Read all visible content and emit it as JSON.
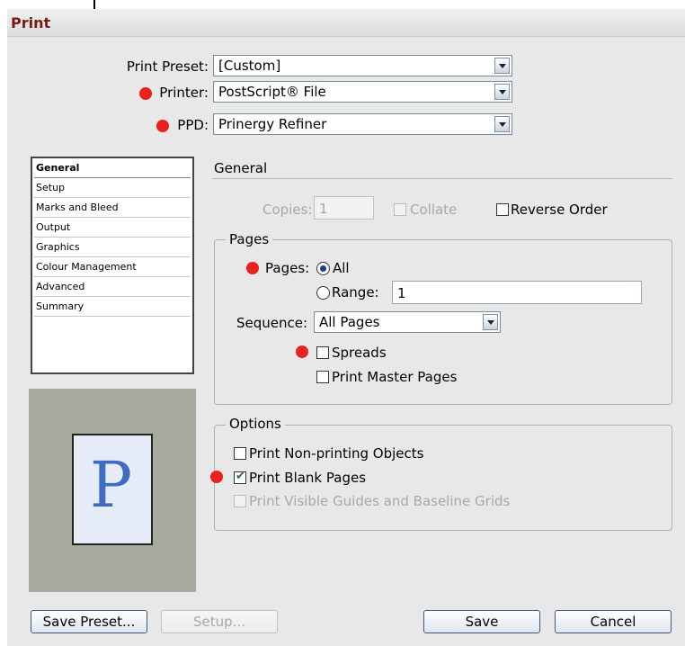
{
  "dialog": {
    "title": "Print"
  },
  "top": {
    "print_preset": {
      "label": "Print Preset:",
      "value": "[Custom]"
    },
    "printer": {
      "label": "Printer:",
      "value": "PostScript® File"
    },
    "ppd": {
      "label": "PPD:",
      "value": "Prinergy Refiner"
    }
  },
  "sidebar": {
    "items": [
      {
        "label": "General"
      },
      {
        "label": "Setup"
      },
      {
        "label": "Marks and Bleed"
      },
      {
        "label": "Output"
      },
      {
        "label": "Graphics"
      },
      {
        "label": "Colour Management"
      },
      {
        "label": "Advanced"
      },
      {
        "label": "Summary"
      }
    ],
    "selected": "General",
    "preview_letter": "P"
  },
  "general": {
    "section_title": "General",
    "copies": {
      "label": "Copies:",
      "value": "1"
    },
    "collate": {
      "label": "Collate",
      "checked": false,
      "enabled": false
    },
    "reverse_order": {
      "label": "Reverse Order",
      "checked": false
    },
    "pages_group": {
      "title": "Pages",
      "pages_label": "Pages:",
      "all_label": "All",
      "range_label": "Range:",
      "range_value": "1",
      "sequence_label": "Sequence:",
      "sequence_value": "All Pages",
      "spreads_label": "Spreads",
      "master_pages_label": "Print Master Pages"
    },
    "options_group": {
      "title": "Options",
      "non_printing_label": "Print Non-printing Objects",
      "blank_pages_label": "Print Blank Pages",
      "guides_label": "Print Visible Guides and Baseline Grids"
    }
  },
  "buttons": {
    "save_preset": "Save Preset...",
    "setup": "Setup...",
    "save": "Save",
    "cancel": "Cancel"
  },
  "colors": {
    "title_text": "#7a1b0f",
    "marker": "#e8231f",
    "preview_bg": "#a7ab9f",
    "preview_letter": "#3f6cc0"
  }
}
